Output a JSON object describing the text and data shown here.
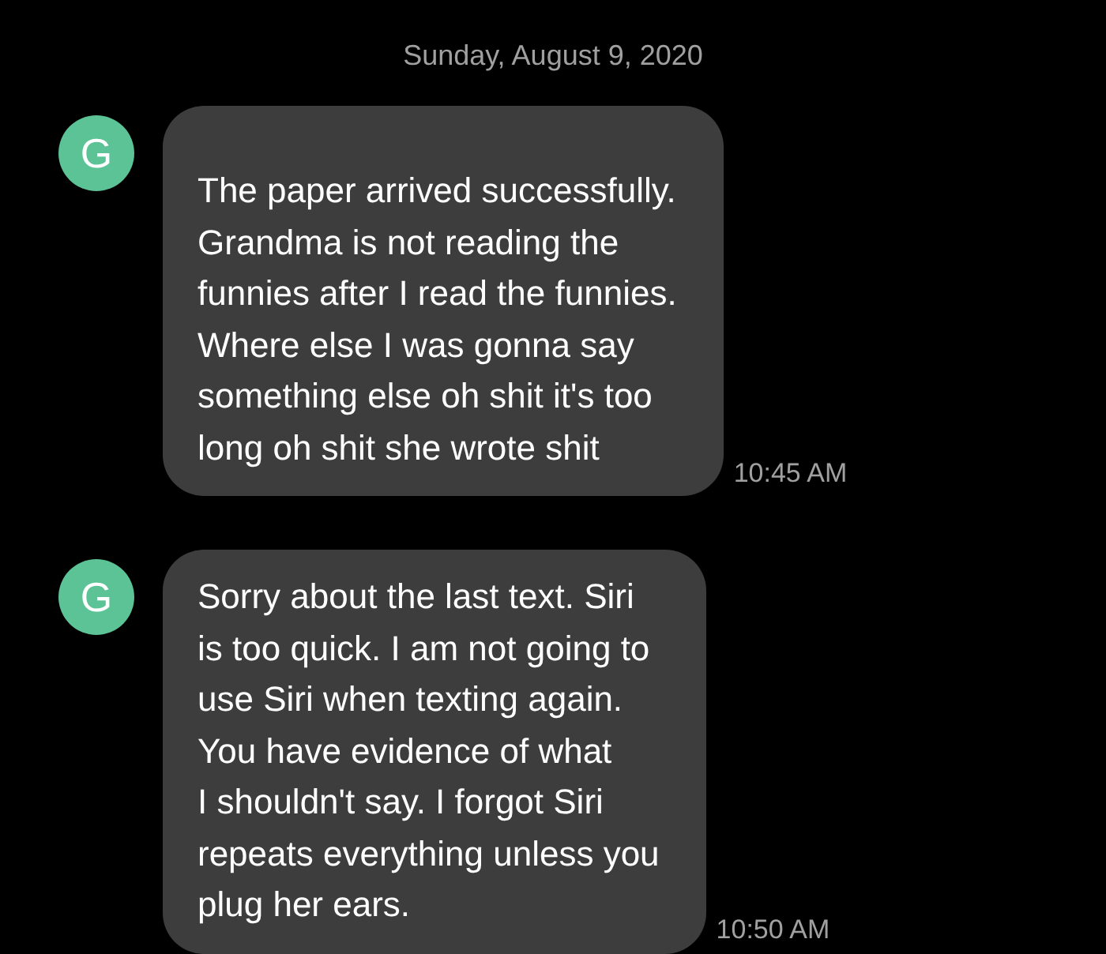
{
  "date_header": "Sunday, August 9, 2020",
  "messages": [
    {
      "avatar": "G",
      "text": "The paper arrived successfully.\nGrandma is not reading the\nfunnies after I read the funnies.\nWhere else I was gonna say\nsomething else oh shit it's too\nlong oh shit she wrote shit",
      "time": "10:45 AM"
    },
    {
      "avatar": "G",
      "text": "Sorry about the last text. Siri\nis too quick. I am not going to\nuse Siri when texting again.\nYou have evidence of what\nI shouldn't say. I forgot Siri\nrepeats everything unless you\nplug her ears.",
      "time": "10:50 AM"
    }
  ]
}
